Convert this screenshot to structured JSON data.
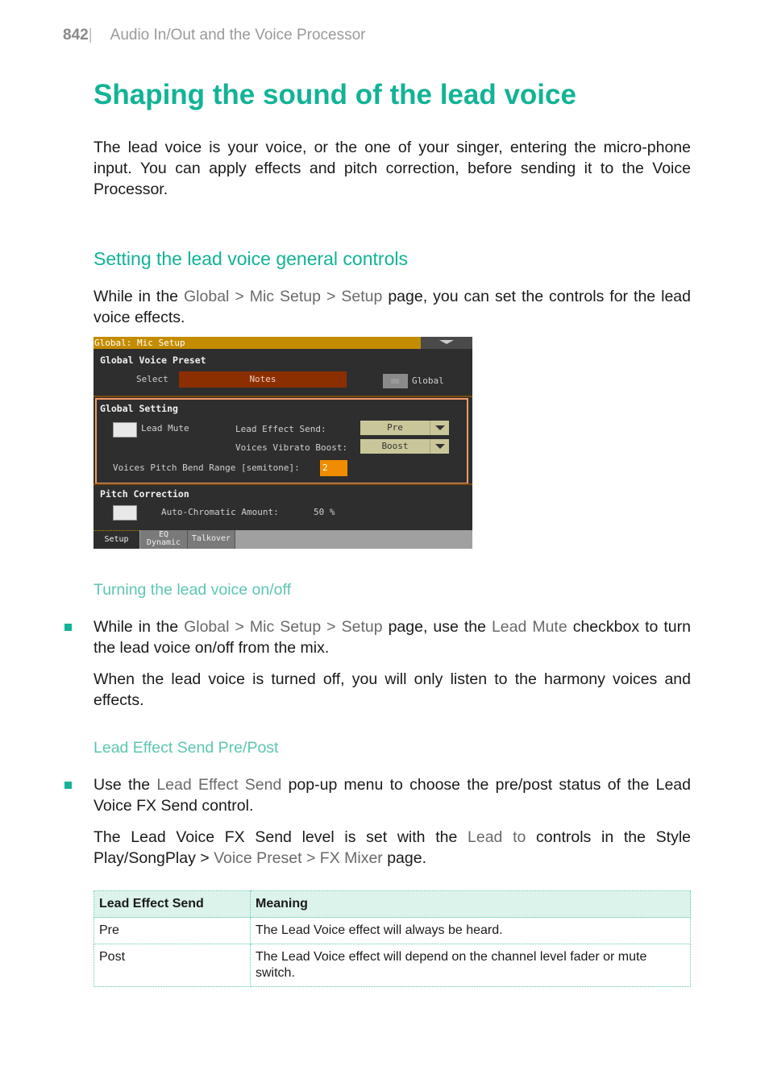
{
  "header": {
    "page_number": "842",
    "separator": "|",
    "chapter": "Audio In/Out and the Voice Processor"
  },
  "title": "Shaping the sound of the lead voice",
  "intro": "The lead voice is your voice, or the one of your singer, entering the micro-phone input. You can apply effects and pitch correction, before sending it to the Voice Processor.",
  "section1": {
    "heading": "Setting the lead voice general controls",
    "para": {
      "pre": "While in the ",
      "ui1": "Global",
      "gt1": " > ",
      "ui2": "Mic Setup",
      "gt2": " > ",
      "ui3": "Setup",
      "post": " page, you can set the controls for the lead voice effects."
    }
  },
  "screenshot": {
    "title_bar": "Global: Mic Setup",
    "global_voice_preset": {
      "heading": "Global Voice Preset",
      "select_label": "Select",
      "select_value": "Notes",
      "global_checkbox_label": "Global"
    },
    "global_setting": {
      "heading": "Global Setting",
      "lead_mute_label": "Lead Mute",
      "lead_effect_send_label": "Lead Effect Send:",
      "lead_effect_send_value": "Pre",
      "vibrato_boost_label": "Voices Vibrato Boost:",
      "vibrato_boost_value": "Boost",
      "pitch_bend_label": "Voices Pitch Bend Range [semitone]:",
      "pitch_bend_value": "2"
    },
    "pitch_correction": {
      "heading": "Pitch Correction",
      "amount_label": "Auto-Chromatic Amount:",
      "amount_value": "50 %"
    },
    "tabs": [
      {
        "label": "Setup"
      },
      {
        "label1": "EQ",
        "label2": "Dynamic"
      },
      {
        "label": "Talkover"
      }
    ]
  },
  "subsection1": {
    "heading": "Turning the lead voice on/off",
    "bullet": {
      "pre": "While in the ",
      "ui1": "Global",
      "gt1": " > ",
      "ui2": "Mic Setup",
      "gt2": " > ",
      "ui3": "Setup",
      "mid": " page, use the ",
      "ui4": "Lead Mute",
      "post": " checkbox to turn the lead voice on/off from the mix."
    },
    "para": "When the lead voice is turned off, you will only listen to the harmony voices and effects."
  },
  "subsection2": {
    "heading": "Lead Effect Send Pre/Post",
    "bullet": {
      "pre": "Use the ",
      "ui1": "Lead Effect Send",
      "post": " pop-up menu to choose the pre/post status of the Lead Voice FX Send control."
    },
    "para": {
      "pre": "The Lead Voice FX Send level is set with the ",
      "ui1": "Lead to",
      "mid": " controls in the Style Play/SongPlay > ",
      "ui2": "Voice Preset",
      "gt": " > ",
      "ui3": "FX Mixer",
      "post": " page."
    }
  },
  "table": {
    "headers": [
      "Lead Effect Send",
      "Meaning"
    ],
    "rows": [
      [
        "Pre",
        "The Lead Voice effect will always be heard."
      ],
      [
        "Post",
        "The Lead Voice effect will depend on the channel level fader or mute switch."
      ]
    ]
  }
}
